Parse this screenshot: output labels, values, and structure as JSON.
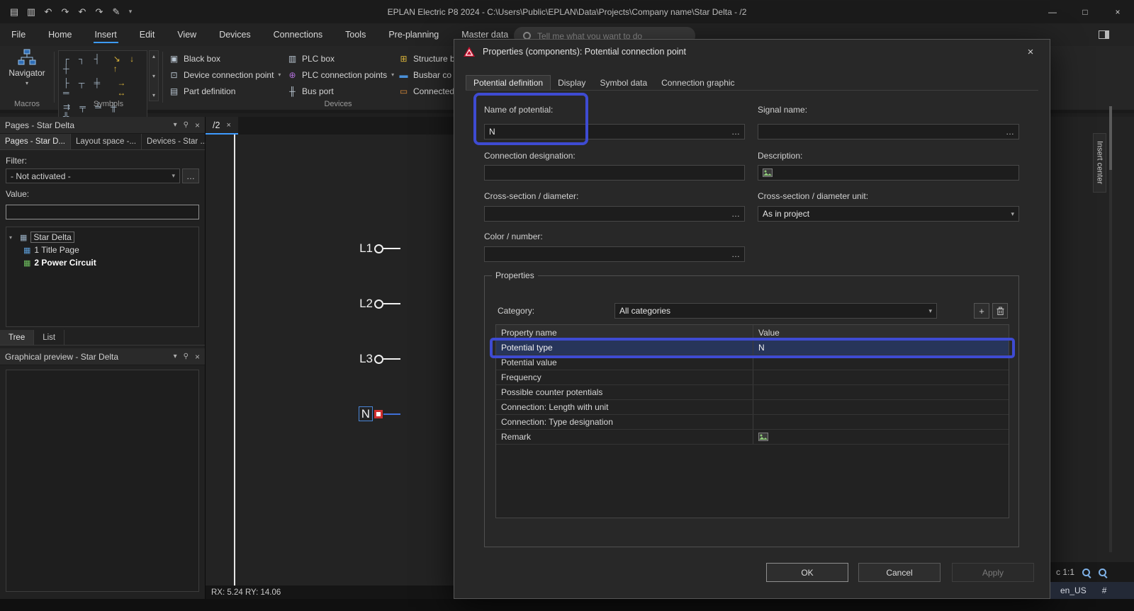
{
  "colors": {
    "accent": "#3d9bff",
    "annotation": "#3e4bd2",
    "warning_red": "#c8102e",
    "selected_row": "#27355a"
  },
  "icons": {
    "page": "▤",
    "copy": "▥",
    "undo": "↶",
    "redo": "↷",
    "pen": "✎",
    "caret_down": "▾",
    "caret_up": "▴",
    "minimize": "—",
    "maximize": "□",
    "close": "×",
    "pin": "⚲",
    "ellipsis": "…",
    "plus": "+",
    "tree_arrow": "▾",
    "project": "▦",
    "page_blue": "▦",
    "page_green": "▦"
  },
  "titlebar": {
    "title": "EPLAN Electric P8 2024 - C:\\Users\\Public\\EPLAN\\Data\\Projects\\Company name\\Star Delta - /2"
  },
  "menubar": {
    "items": [
      "File",
      "Home",
      "Insert",
      "Edit",
      "View",
      "Devices",
      "Connections",
      "Tools",
      "Pre-planning",
      "Master data"
    ],
    "active": "Insert",
    "search_placeholder": "Tell me what you want to do"
  },
  "ribbon": {
    "navigator_label": "Navigator",
    "groups": {
      "macros": "Macros",
      "symbols": "Symbols",
      "devices": "Devices"
    },
    "symbols_rows": [
      {
        "gray": "┌ ┐ ┤ ┼",
        "accent": "↘ ↓ ↑"
      },
      {
        "gray": "├ ┬ ╪ ═",
        "accent": "→ ↔"
      },
      {
        "gray": "⇉ ╤ ╧ ╫ ╬",
        "accent": ""
      }
    ],
    "devices": {
      "col1": [
        {
          "icon": "▣",
          "label": "Black box"
        },
        {
          "icon": "⊡",
          "label": "Device connection point"
        },
        {
          "icon": "▤",
          "label": "Part definition"
        }
      ],
      "col2": [
        {
          "icon": "▥",
          "label": "PLC box"
        },
        {
          "icon": "⊕",
          "label": "PLC connection points"
        },
        {
          "icon": "╫",
          "label": "Bus port"
        }
      ],
      "col3": [
        {
          "icon": "⊞",
          "label": "Structure b"
        },
        {
          "icon": "▬",
          "label": "Busbar co"
        },
        {
          "icon": "▭",
          "label": "Connected"
        }
      ]
    }
  },
  "left_panel": {
    "header": "Pages - Star Delta",
    "tabs": [
      "Pages - Star D...",
      "Layout space -...",
      "Devices - Star ..."
    ],
    "filter_label": "Filter:",
    "filter_value": "- Not activated -",
    "value_label": "Value:",
    "value_text": "",
    "tree": {
      "project": "Star Delta",
      "items": [
        "1 Title Page",
        "2 Power Circuit"
      ]
    },
    "bottom_tabs": [
      "Tree",
      "List"
    ],
    "preview_header": "Graphical preview - Star Delta"
  },
  "editor": {
    "tab": "/2",
    "labels": [
      "L1",
      "L2",
      "L3",
      "N"
    ],
    "status": "RX: 5.24 RY: 14.06"
  },
  "dialog": {
    "title": "Properties (components): Potential connection point",
    "tabs": [
      "Potential definition",
      "Display",
      "Symbol data",
      "Connection graphic"
    ],
    "fields": {
      "name_label": "Name of potential:",
      "name_value": "N",
      "signal_label": "Signal name:",
      "signal_value": "",
      "conn_label": "Connection designation:",
      "conn_value": "",
      "desc_label": "Description:",
      "desc_value": "",
      "cross_label": "Cross-section / diameter:",
      "cross_value": "",
      "cross_unit_label": "Cross-section / diameter unit:",
      "cross_unit_value": "As in project",
      "color_label": "Color / number:",
      "color_value": ""
    },
    "properties": {
      "legend": "Properties",
      "category_label": "Category:",
      "category_value": "All categories",
      "col_name": "Property name",
      "col_value": "Value",
      "rows": [
        {
          "name": "Potential type",
          "value": "N"
        },
        {
          "name": "Potential value",
          "value": ""
        },
        {
          "name": "Frequency",
          "value": ""
        },
        {
          "name": "Possible counter potentials",
          "value": ""
        },
        {
          "name": "Connection: Length with unit",
          "value": ""
        },
        {
          "name": "Connection: Type designation",
          "value": ""
        },
        {
          "name": "Remark",
          "value": ""
        }
      ]
    },
    "buttons": {
      "ok": "OK",
      "cancel": "Cancel",
      "apply": "Apply"
    }
  },
  "statusbar": {
    "zoom": "c 1:1",
    "lang": "en_US",
    "hash": "#"
  },
  "right_panel": {
    "insert_center": "Insert center"
  }
}
